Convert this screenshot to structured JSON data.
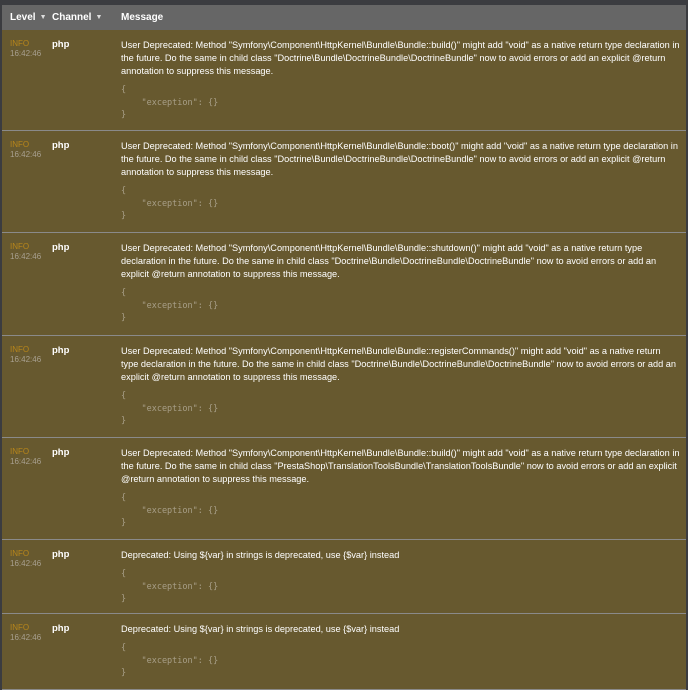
{
  "columns": {
    "level": "Level",
    "channel": "Channel",
    "message": "Message"
  },
  "rows": [
    {
      "level": "INFO",
      "time": "16:42:46",
      "channel": "php",
      "message": "User Deprecated: Method \"Symfony\\Component\\HttpKernel\\Bundle\\Bundle::build()\" might add \"void\" as a native return type declaration in the future. Do the same in child class \"Doctrine\\Bundle\\DoctrineBundle\\DoctrineBundle\" now to avoid errors or add an explicit @return annotation to suppress this message.",
      "context": "{\n    \"exception\": {}\n}"
    },
    {
      "level": "INFO",
      "time": "16:42:46",
      "channel": "php",
      "message": "User Deprecated: Method \"Symfony\\Component\\HttpKernel\\Bundle\\Bundle::boot()\" might add \"void\" as a native return type declaration in the future. Do the same in child class \"Doctrine\\Bundle\\DoctrineBundle\\DoctrineBundle\" now to avoid errors or add an explicit @return annotation to suppress this message.",
      "context": "{\n    \"exception\": {}\n}"
    },
    {
      "level": "INFO",
      "time": "16:42:46",
      "channel": "php",
      "message": "User Deprecated: Method \"Symfony\\Component\\HttpKernel\\Bundle\\Bundle::shutdown()\" might add \"void\" as a native return type declaration in the future. Do the same in child class \"Doctrine\\Bundle\\DoctrineBundle\\DoctrineBundle\" now to avoid errors or add an explicit @return annotation to suppress this message.",
      "context": "{\n    \"exception\": {}\n}"
    },
    {
      "level": "INFO",
      "time": "16:42:46",
      "channel": "php",
      "message": "User Deprecated: Method \"Symfony\\Component\\HttpKernel\\Bundle\\Bundle::registerCommands()\" might add \"void\" as a native return type declaration in the future. Do the same in child class \"Doctrine\\Bundle\\DoctrineBundle\\DoctrineBundle\" now to avoid errors or add an explicit @return annotation to suppress this message.",
      "context": "{\n    \"exception\": {}\n}"
    },
    {
      "level": "INFO",
      "time": "16:42:46",
      "channel": "php",
      "message": "User Deprecated: Method \"Symfony\\Component\\HttpKernel\\Bundle\\Bundle::build()\" might add \"void\" as a native return type declaration in the future. Do the same in child class \"PrestaShop\\TranslationToolsBundle\\TranslationToolsBundle\" now to avoid errors or add an explicit @return annotation to suppress this message.",
      "context": "{\n    \"exception\": {}\n}"
    },
    {
      "level": "INFO",
      "time": "16:42:46",
      "channel": "php",
      "message": "Deprecated: Using ${var} in strings is deprecated, use {$var} instead",
      "context": "{\n    \"exception\": {}\n}"
    },
    {
      "level": "INFO",
      "time": "16:42:46",
      "channel": "php",
      "message": "Deprecated: Using ${var} in strings is deprecated, use {$var} instead",
      "context": "{\n    \"exception\": {}\n}"
    }
  ]
}
